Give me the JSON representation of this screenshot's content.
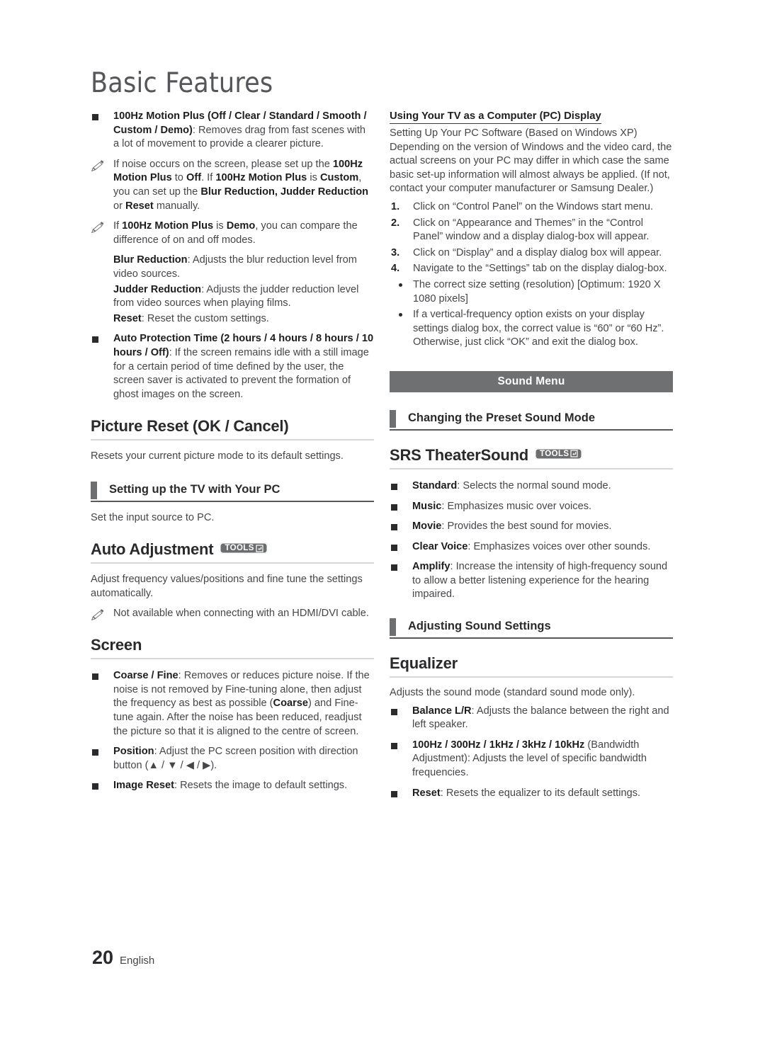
{
  "document": {
    "title": "Basic Features",
    "footer": {
      "page_number": "20",
      "language": "English"
    }
  },
  "tools_badge": {
    "label": "TOOLS"
  },
  "left_column": {
    "motion_plus": {
      "term": "100Hz Motion Plus (Off / Clear / Standard / Smooth / Custom / Demo)",
      "desc": ": Removes drag from fast scenes with a lot of movement to provide a clearer picture."
    },
    "note_1": {
      "part1": "If noise occurs on the screen, please set up the ",
      "b1": "100Hz Motion Plus",
      "part2": " to ",
      "b2": "Off",
      "part3": ". If ",
      "b3": "100Hz Motion Plus",
      "part4": " is ",
      "b4": "Custom",
      "part5": ", you can set up the ",
      "b5": "Blur Reduction, Judder Reduction",
      "part6": " or ",
      "b6": "Reset",
      "part7": " manually."
    },
    "note_2": {
      "part1": "If ",
      "b1": "100Hz Motion Plus",
      "part2": " is ",
      "b2": "Demo",
      "part3": ", you can compare the difference of on and off modes."
    },
    "blur_reduction": {
      "term": "Blur Reduction",
      "desc": ": Adjusts the blur reduction level from video sources."
    },
    "judder_reduction": {
      "term": "Judder Reduction",
      "desc": ": Adjusts the judder reduction level from video sources when playing films."
    },
    "reset_custom": {
      "term": "Reset",
      "desc": ": Reset the custom settings."
    },
    "auto_protection": {
      "term": "Auto Protection Time (2 hours / 4 hours / 8 hours / 10 hours / Off)",
      "desc": ": If the screen remains idle with a still image for a certain period of time defined by the user, the screen saver is activated to prevent the formation of ghost images on the screen."
    },
    "picture_reset": {
      "heading": "Picture Reset (OK / Cancel)",
      "body": "Resets your current picture mode to its default settings."
    },
    "setting_up_pc": {
      "heading": "Setting up the TV with Your PC",
      "body": "Set the input source to PC."
    },
    "auto_adjustment": {
      "heading": "Auto Adjustment",
      "body": "Adjust frequency values/positions and fine tune the settings automatically.",
      "note": "Not available when connecting with an HDMI/DVI cable."
    },
    "screen": {
      "heading": "Screen",
      "coarse_fine": {
        "term": "Coarse / Fine",
        "desc_a": ": Removes or reduces picture noise. If the noise is not removed by Fine-tuning alone, then adjust the frequency as best as possible (",
        "b_inline": "Coarse",
        "desc_b": ") and Fine-tune again. After the noise has been reduced, readjust the picture so that it is aligned to the centre of screen."
      },
      "position": {
        "term": "Position",
        "desc": ": Adjust the PC screen position with direction button (▲ / ▼ / ◀ / ▶)."
      },
      "image_reset": {
        "term": "Image Reset",
        "desc": ": Resets the image to default settings."
      }
    }
  },
  "right_column": {
    "pc_display": {
      "heading": "Using Your TV as a Computer (PC) Display",
      "subtitle": "Setting Up Your PC Software (Based on Windows XP)",
      "intro": "Depending on the version of Windows and the video card, the actual screens on your PC may differ in which case the same basic set-up information will almost always be applied. (If not, contact your computer manufacturer or Samsung Dealer.)",
      "steps": [
        {
          "num": "1.",
          "text": "Click on “Control Panel” on the Windows start menu."
        },
        {
          "num": "2.",
          "text": "Click on “Appearance and Themes” in the “Control Panel” window and a display dialog-box will appear."
        },
        {
          "num": "3.",
          "text": "Click on “Display” and a display dialog box will appear."
        },
        {
          "num": "4.",
          "text": "Navigate to the “Settings” tab on the display dialog-box."
        }
      ],
      "bullets": [
        "The correct size setting (resolution) [Optimum: 1920 X 1080 pixels]",
        "If a vertical-frequency option exists on your display settings dialog box, the correct value is “60” or “60 Hz”. Otherwise, just click “OK” and exit the dialog box."
      ]
    },
    "sound_menu_banner": "Sound Menu",
    "changing_preset": {
      "heading": "Changing the Preset Sound Mode"
    },
    "srs_theatersound": {
      "heading": "SRS TheaterSound",
      "items": [
        {
          "term": "Standard",
          "desc": ": Selects the normal sound mode."
        },
        {
          "term": "Music",
          "desc": ": Emphasizes music over voices."
        },
        {
          "term": "Movie",
          "desc": ": Provides the best sound for movies."
        },
        {
          "term": "Clear Voice",
          "desc": ": Emphasizes voices over other sounds."
        },
        {
          "term": "Amplify",
          "desc": ": Increase the intensity of high-frequency sound to allow a better listening experience for the hearing impaired."
        }
      ]
    },
    "adjusting_sound": {
      "heading": "Adjusting Sound Settings"
    },
    "equalizer": {
      "heading": "Equalizer",
      "body": "Adjusts the sound mode (standard sound mode only).",
      "items": [
        {
          "term": "Balance L/R",
          "desc": ": Adjusts the balance between the right and left speaker."
        },
        {
          "term": "100Hz / 300Hz / 1kHz / 3kHz / 10kHz",
          "desc": " (Bandwidth Adjustment): Adjusts the level of specific bandwidth frequencies."
        },
        {
          "term": "Reset",
          "desc": ": Resets the equalizer to its default settings."
        }
      ]
    }
  },
  "colors": {
    "banner_gray": "#6e7072",
    "bar_gray": "#6d6f71",
    "text_body": "#46464a",
    "text_bold": "#1d1d1f",
    "rule_light": "#d7d7d9"
  }
}
